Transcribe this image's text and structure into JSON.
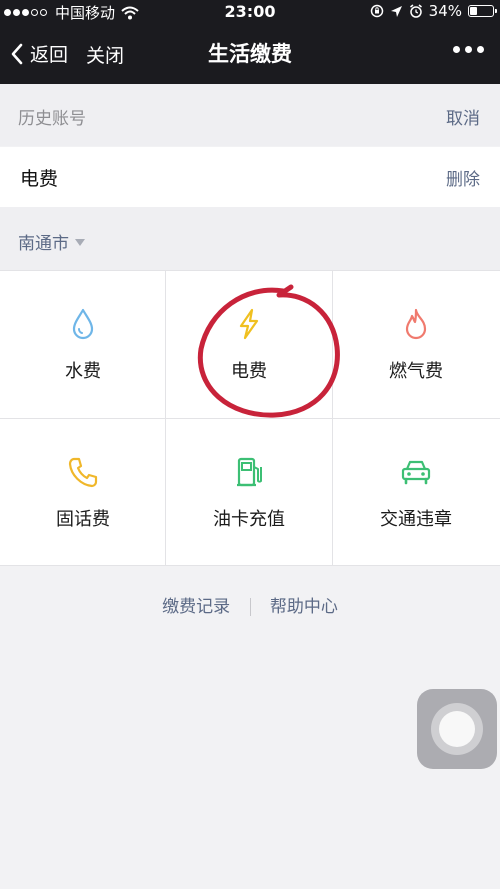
{
  "status_bar": {
    "carrier": "中国移动",
    "time": "23:00",
    "battery": "34%",
    "battery_level": 0.34
  },
  "nav": {
    "back_label": "返回",
    "close_label": "关闭",
    "title": "生活缴费"
  },
  "history": {
    "label": "历史账号",
    "action": "取消"
  },
  "account": {
    "label": "电费",
    "action": "删除"
  },
  "city": {
    "name": "南通市"
  },
  "services": [
    {
      "label": "水费",
      "icon": "water-drop-icon",
      "color": "#6fb6e8"
    },
    {
      "label": "电费",
      "icon": "lightning-icon",
      "color": "#f0c020"
    },
    {
      "label": "燃气费",
      "icon": "flame-icon",
      "color": "#f07a6e"
    },
    {
      "label": "固话费",
      "icon": "phone-icon",
      "color": "#f0b72a"
    },
    {
      "label": "油卡充值",
      "icon": "gas-pump-icon",
      "color": "#3cbf74"
    },
    {
      "label": "交通违章",
      "icon": "car-icon",
      "color": "#3cbf74"
    }
  ],
  "footer": {
    "records": "缴费记录",
    "help": "帮助中心"
  },
  "colors": {
    "nav_bg": "#1b1b1f",
    "link": "#5c6a86",
    "annotation": "#c8233a"
  }
}
